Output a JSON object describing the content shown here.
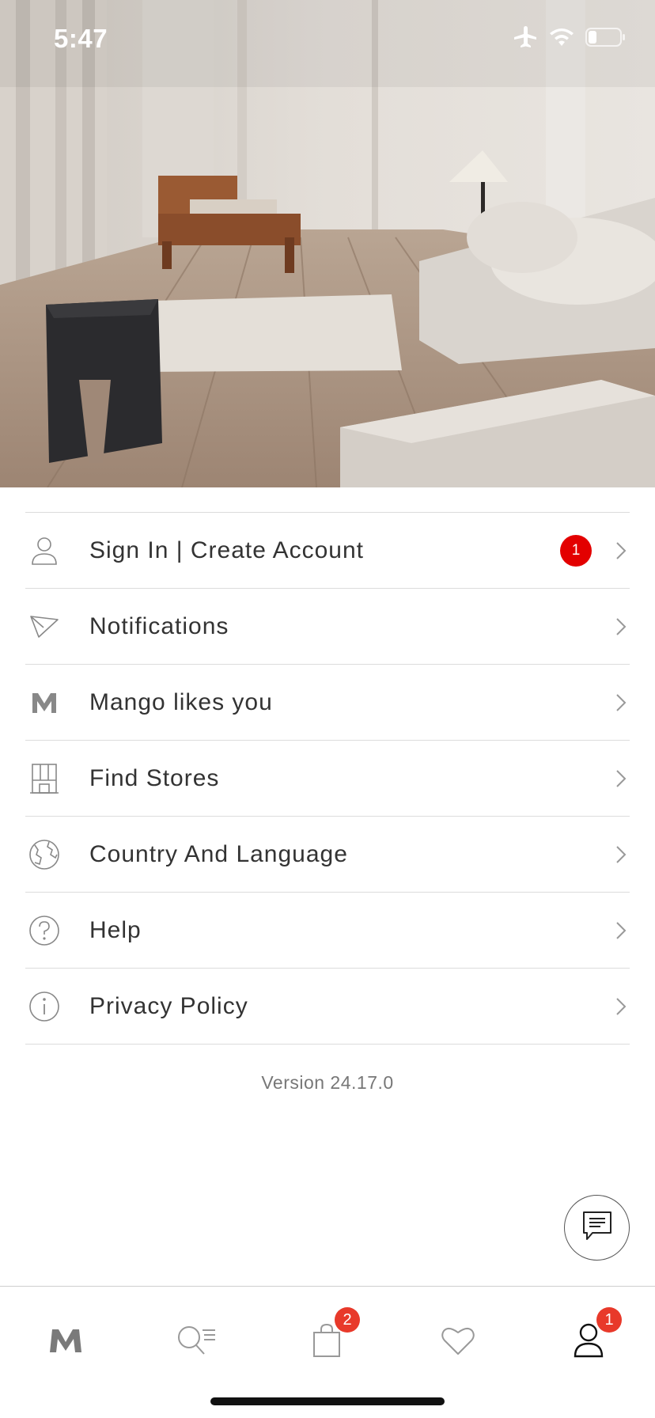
{
  "status_bar": {
    "time": "5:47",
    "icons": [
      "airplane-icon",
      "wifi-icon",
      "battery-icon"
    ]
  },
  "hero": {
    "image": "living-room-photo"
  },
  "menu": {
    "items": [
      {
        "label": "Sign In | Create Account",
        "icon": "user-icon",
        "badge": "1"
      },
      {
        "label": "Notifications",
        "icon": "paper-plane-icon"
      },
      {
        "label": "Mango likes you",
        "icon": "mango-m-icon"
      },
      {
        "label": "Find Stores",
        "icon": "store-icon"
      },
      {
        "label": "Country And Language",
        "icon": "globe-icon"
      },
      {
        "label": "Help",
        "icon": "question-icon"
      },
      {
        "label": "Privacy Policy",
        "icon": "info-icon"
      }
    ]
  },
  "version": "Version 24.17.0",
  "chat": {
    "icon": "chat-icon"
  },
  "tabbar": {
    "tabs": [
      {
        "name": "home",
        "icon": "mango-logo-icon"
      },
      {
        "name": "search",
        "icon": "search-list-icon"
      },
      {
        "name": "bag",
        "icon": "bag-icon",
        "badge": "2"
      },
      {
        "name": "favorites",
        "icon": "heart-icon"
      },
      {
        "name": "account",
        "icon": "user-icon",
        "badge": "1",
        "active": true
      }
    ]
  },
  "colors": {
    "badge": "#e30000",
    "tab_badge": "#e8392a",
    "divider": "#dcdcdc"
  }
}
